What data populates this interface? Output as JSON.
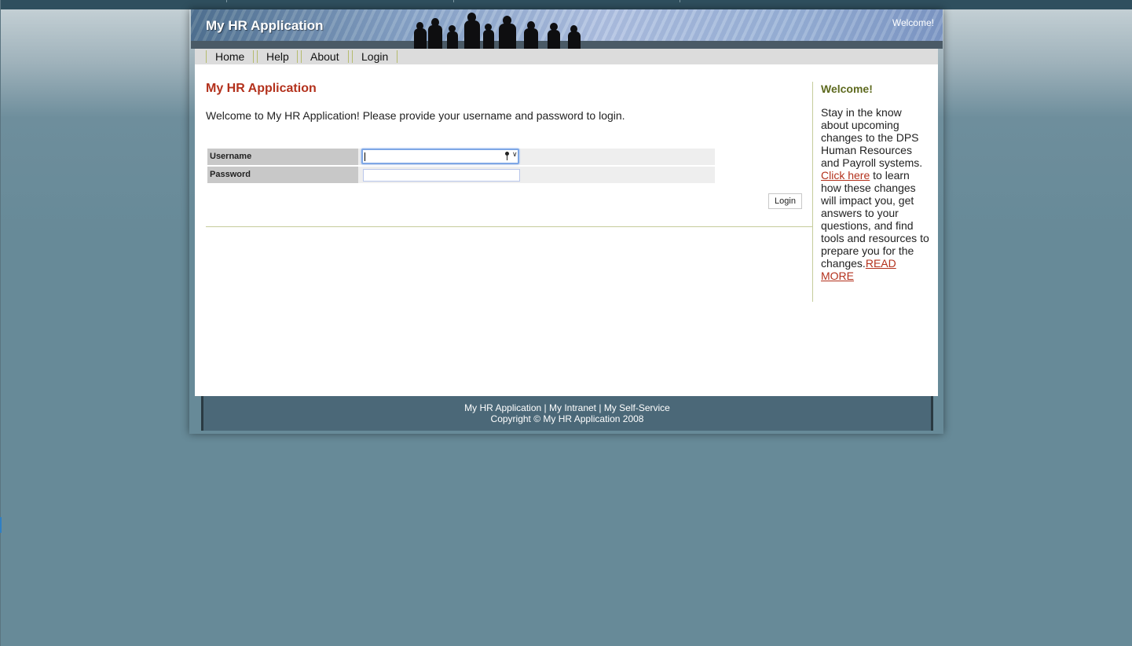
{
  "header": {
    "app_title": "My HR Application",
    "welcome": "Welcome!"
  },
  "nav": {
    "items": [
      "Home",
      "Help",
      "About",
      "Login"
    ]
  },
  "main": {
    "title": "My HR Application",
    "intro": "Welcome to My HR Application! Please provide your username and password to login.",
    "form": {
      "username_label": "Username",
      "username_value": "",
      "password_label": "Password",
      "password_value": "",
      "login_button": "Login"
    }
  },
  "sidebar": {
    "title": "Welcome!",
    "text_1": "Stay in the know about upcoming changes to the DPS Human Resources and Payroll systems.",
    "link_1": "Click here",
    "text_2": " to learn how these changes will impact you, get answers to your questions, and find tools and resources to prepare you for the changes.",
    "link_2": "READ MORE"
  },
  "footer": {
    "links": [
      "My HR Application",
      "My Intranet",
      "My Self-Service"
    ],
    "separator": " | ",
    "copyright": "Copyright © My HR Application 2008"
  },
  "colors": {
    "title_red": "#b3311c",
    "sidebar_title_olive": "#5e6a1f",
    "footer_bg": "#4b6878",
    "page_bg": "#678a98"
  },
  "icons": [
    "key-icon",
    "chevron-down-icon"
  ]
}
